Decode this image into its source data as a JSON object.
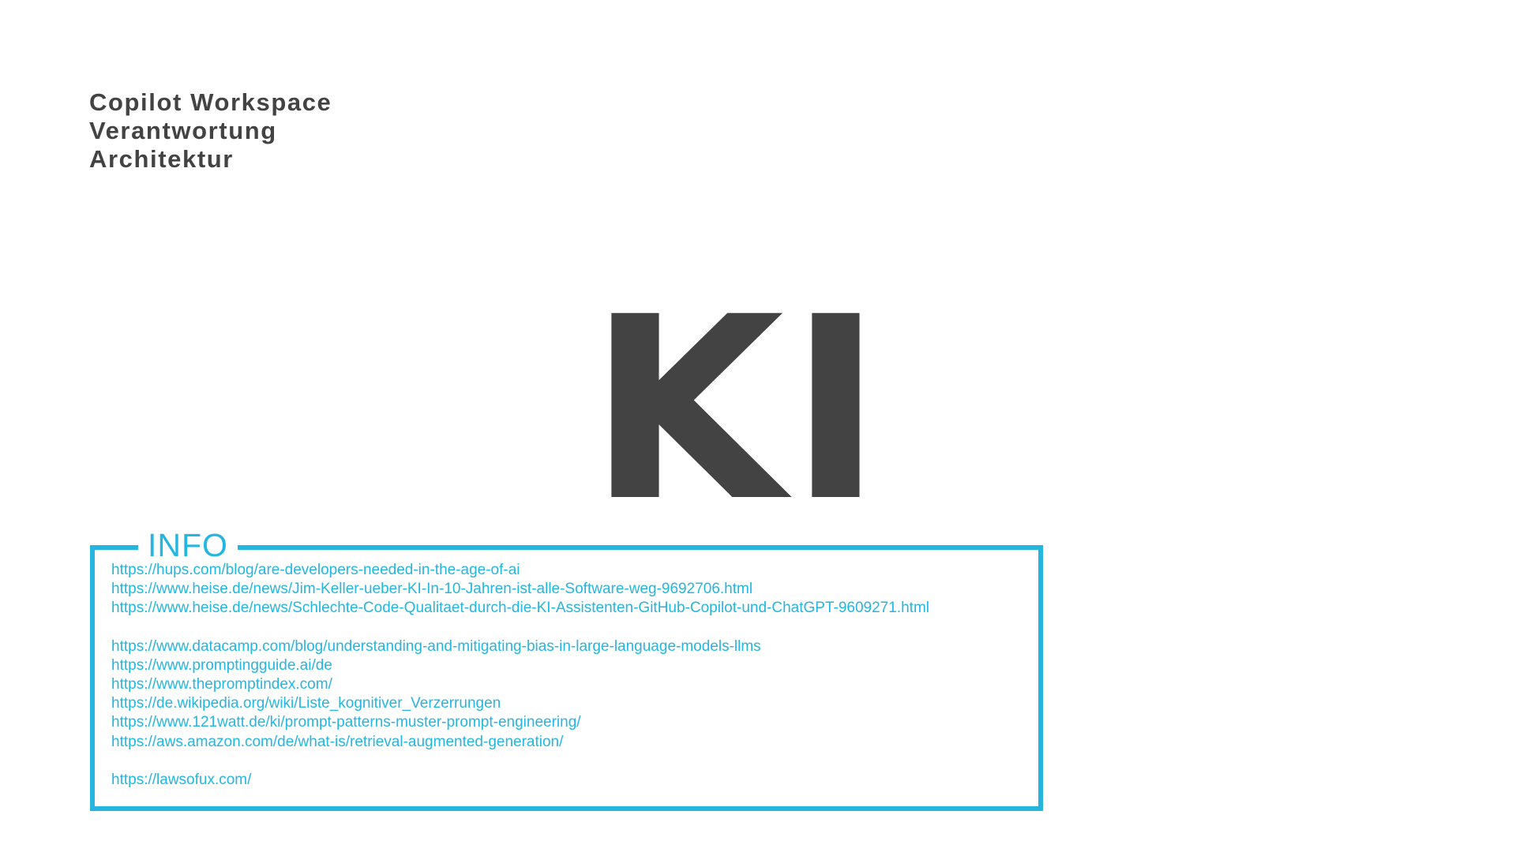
{
  "topics": [
    "Copilot Workspace",
    "Verantwortung",
    "Architektur"
  ],
  "hero": {
    "text": "KI"
  },
  "info": {
    "title": "INFO",
    "groups": [
      [
        "https://hups.com/blog/are-developers-needed-in-the-age-of-ai",
        "https://www.heise.de/news/Jim-Keller-ueber-KI-In-10-Jahren-ist-alle-Software-weg-9692706.html",
        "https://www.heise.de/news/Schlechte-Code-Qualitaet-durch-die-KI-Assistenten-GitHub-Copilot-und-ChatGPT-9609271.html"
      ],
      [
        "https://www.datacamp.com/blog/understanding-and-mitigating-bias-in-large-language-models-llms",
        "https://www.promptingguide.ai/de",
        "https://www.thepromptindex.com/",
        "https://de.wikipedia.org/wiki/Liste_kognitiver_Verzerrungen",
        "https://www.121watt.de/ki/prompt-patterns-muster-prompt-engineering/",
        "https://aws.amazon.com/de/what-is/retrieval-augmented-generation/"
      ],
      [
        "https://lawsofux.com/"
      ]
    ]
  },
  "colors": {
    "text_dark": "#434343",
    "accent": "#25b6df",
    "background": "#ffffff"
  }
}
